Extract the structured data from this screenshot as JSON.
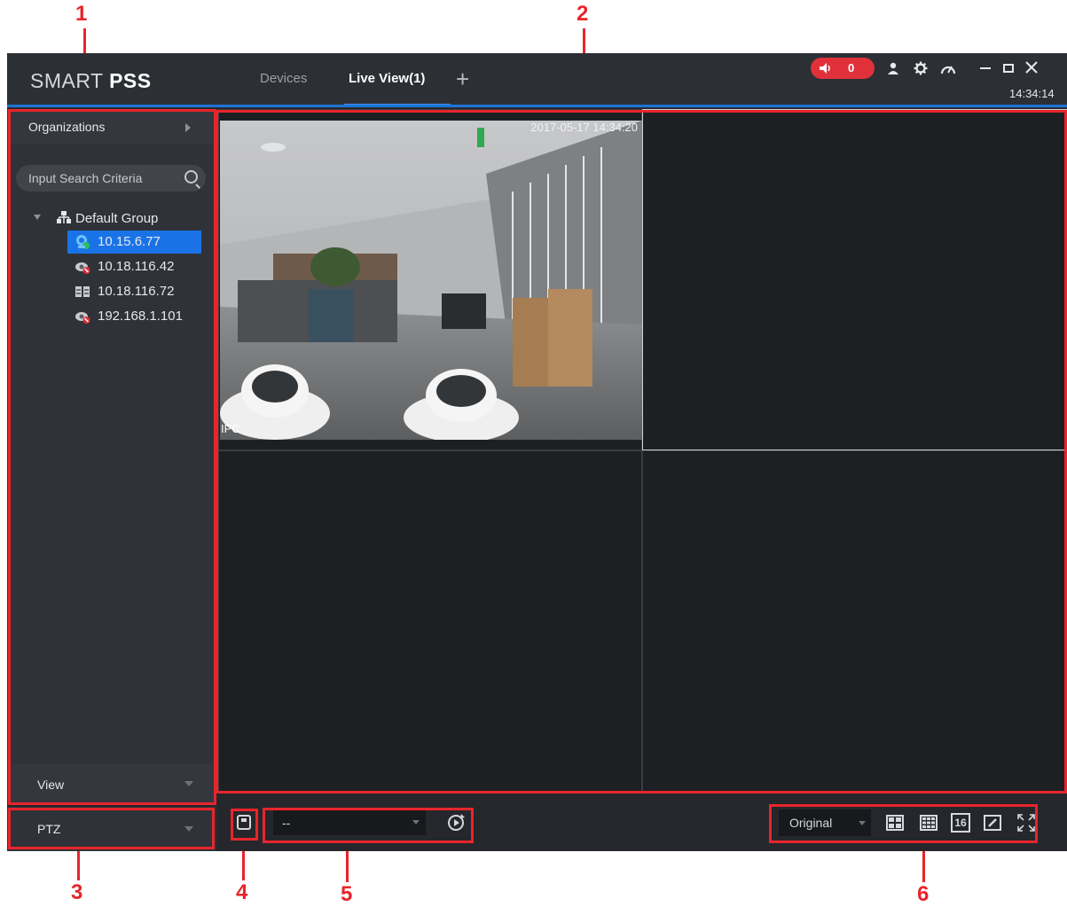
{
  "app": {
    "title_light": "SMART",
    "title_bold": "PSS",
    "clock": "14:34:14"
  },
  "tabs": [
    {
      "label": "Devices",
      "active": false
    },
    {
      "label": "Live View(1)",
      "active": true
    }
  ],
  "titlebar": {
    "alarm_count": "0",
    "icons": [
      "speaker-icon",
      "user-icon",
      "settings-icon",
      "performance-gauge-icon",
      "minimize-icon",
      "maximize-icon",
      "close-icon"
    ],
    "alarm_color": "#e0313a",
    "accent_color": "#1e74d6"
  },
  "sidebar": {
    "organizations_label": "Organizations",
    "search_placeholder": "Input Search Criteria",
    "group_label": "Default Group",
    "devices": [
      {
        "label": "10.15.6.77",
        "icon": "ipc-online-icon",
        "selected": true
      },
      {
        "label": "10.18.116.42",
        "icon": "camera-offline-icon",
        "selected": false
      },
      {
        "label": "10.18.116.72",
        "icon": "nvr-icon",
        "selected": false
      },
      {
        "label": "192.168.1.101",
        "icon": "camera-offline-icon",
        "selected": false
      }
    ],
    "view_label": "View",
    "ptz_label": "PTZ",
    "selected_color": "#1a73e6"
  },
  "video": {
    "timestamp": "2017-05-17 14:34:20",
    "channel_label": "IPC"
  },
  "toolbar": {
    "view_select_value": "--",
    "fit_select_value": "Original",
    "layout_16_label": "16",
    "icons": [
      "save-view-icon",
      "cycle-icon",
      "layout-4-icon",
      "layout-9-icon",
      "layout-16-icon",
      "custom-layout-icon",
      "fullscreen-icon"
    ]
  },
  "callouts": [
    "1",
    "2",
    "3",
    "4",
    "5",
    "6"
  ]
}
